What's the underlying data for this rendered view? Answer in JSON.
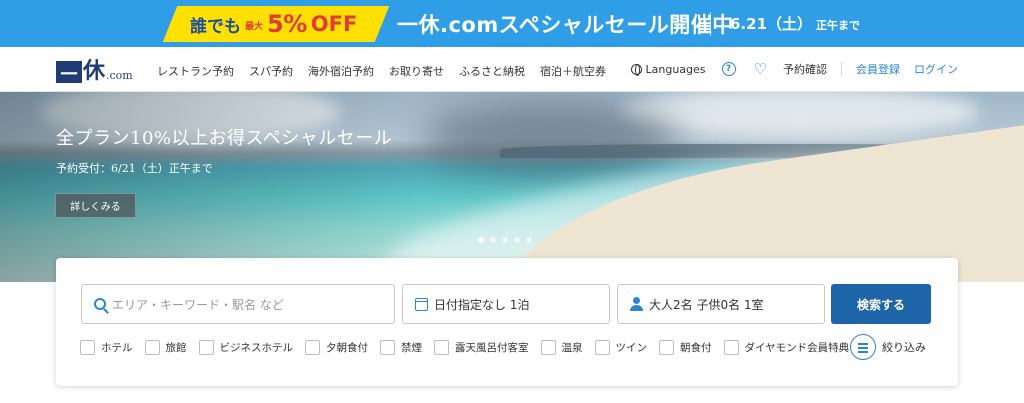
{
  "promo": {
    "part1": "誰でも",
    "small": "最大",
    "percent": "5%",
    "off": "OFF",
    "headline": "一休.comスペシャルセール開催中",
    "date": "6.21（土）",
    "date_sub": "正午まで",
    "colors": {
      "background": "#2f9ee6",
      "highlight": "#ffe000",
      "accent": "#e23a3a"
    }
  },
  "header": {
    "logo": {
      "mark": "一",
      "kanji": "休",
      "suffix": ".com"
    },
    "nav": [
      "レストラン予約",
      "スパ予約",
      "海外宿泊予約",
      "お取り寄せ",
      "ふるさと納税",
      "宿泊＋航空券"
    ],
    "languages": "Languages",
    "reservation": "予約確認",
    "register": "会員登録",
    "login": "ログイン"
  },
  "hero": {
    "title": "全プラン10%以上お得スペシャルセール",
    "subtitle": "予約受付：6/21（土）正午まで",
    "button": "詳しくみる",
    "slides": 5,
    "active_slide": 1
  },
  "search": {
    "area_placeholder": "エリア・キーワード・駅名 など",
    "date_value": "日付指定なし 1泊",
    "guest_value": "大人2名 子供0名 1室",
    "submit": "検索する",
    "filters": [
      "ホテル",
      "旅館",
      "ビジネスホテル",
      "夕朝食付",
      "禁煙",
      "露天風呂付客室",
      "温泉",
      "ツイン",
      "朝食付",
      "ダイヤモンド会員特典"
    ],
    "refine": "絞り込み",
    "accent_color": "#1e64a8"
  }
}
